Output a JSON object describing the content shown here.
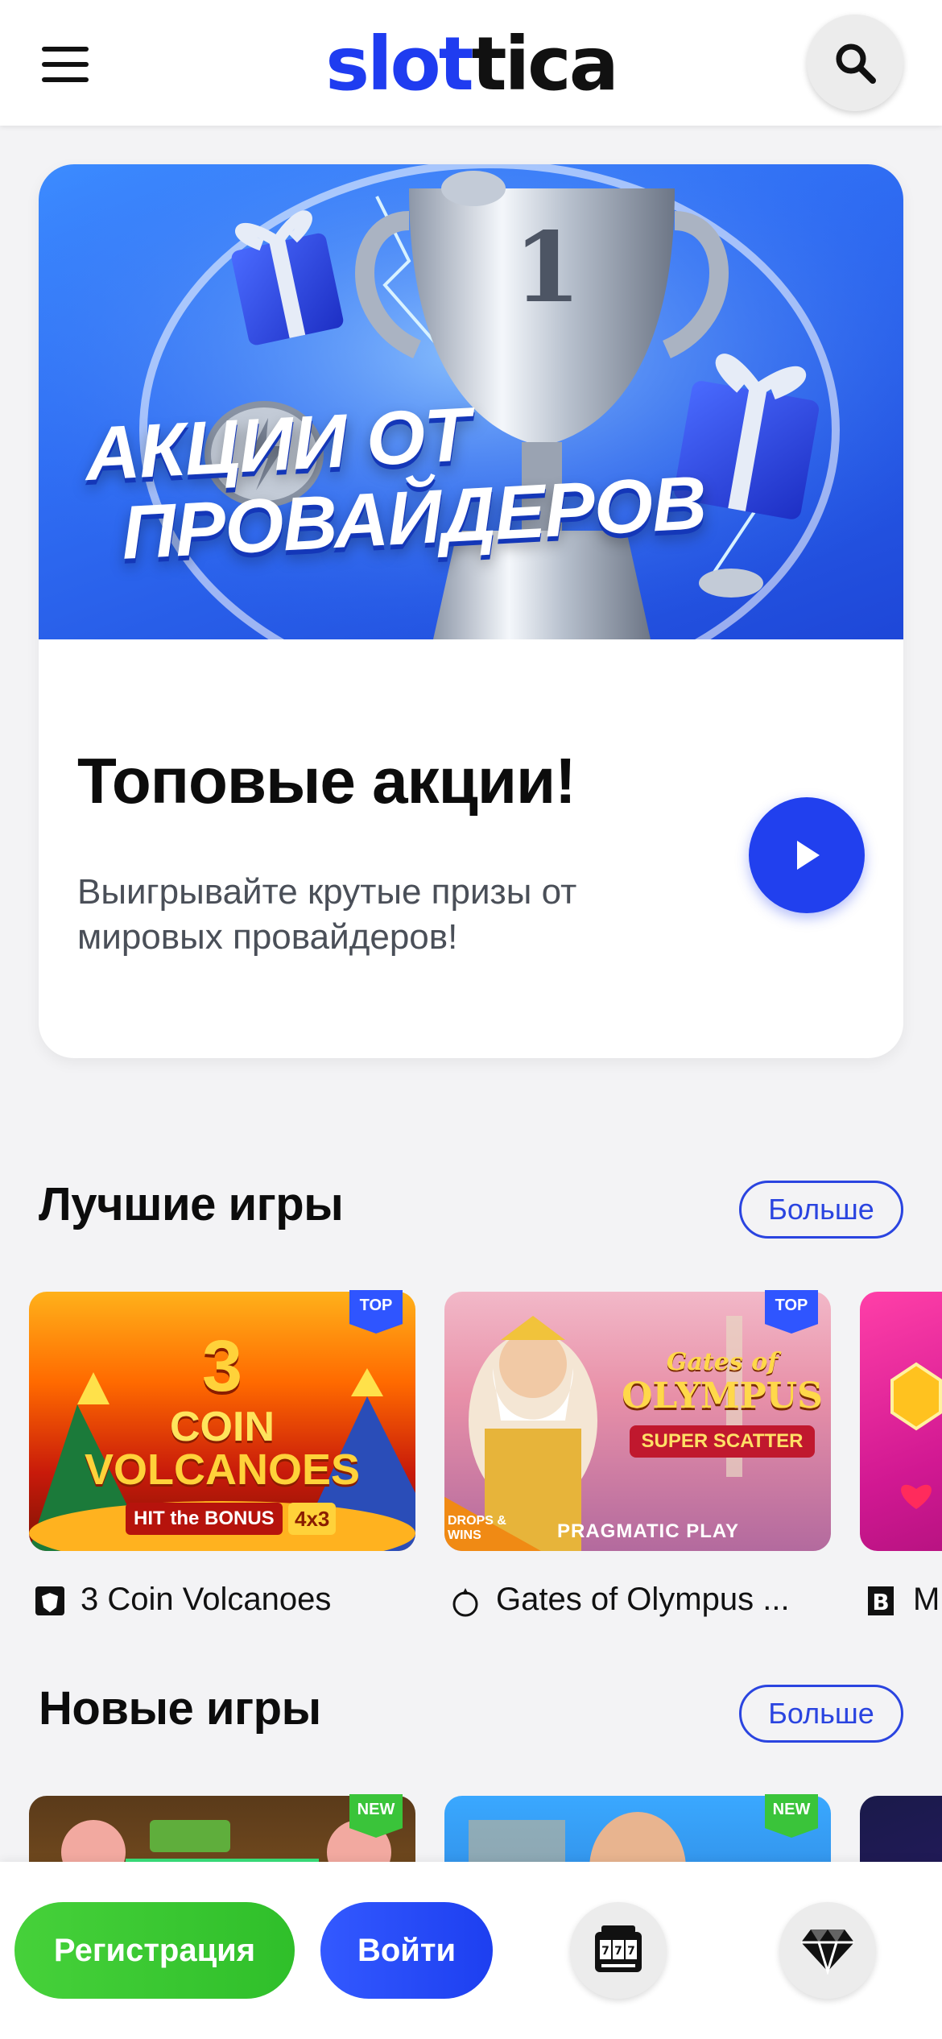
{
  "header": {
    "logo_part1": "slot",
    "logo_part2": "tica",
    "menu_icon": "hamburger-icon",
    "search_icon": "search-icon"
  },
  "promo": {
    "banner_line1": "АКЦИИ ОТ",
    "banner_line2": "ПРОВАЙДЕРОВ",
    "title": "Топовые акции!",
    "text": "Выигрывайте крутые призы от мировых провайдеров!",
    "play_icon": "play-icon"
  },
  "best_games": {
    "title": "Лучшие игры",
    "more_label": "Больше",
    "items": [
      {
        "name": "3 Coin Volcanoes",
        "badge": "TOP",
        "thumb_line1": "3",
        "thumb_line2": "COIN",
        "thumb_line3": "VOLCANOES",
        "thumb_line4": "HIT the BONUS",
        "thumb_line5": "4x3"
      },
      {
        "name": "Gates of Olympus ...",
        "badge": "TOP",
        "thumb_line1": "Gates of",
        "thumb_line2": "OLYMPUS",
        "thumb_line3": "SUPER SCATTER",
        "thumb_line4": "PRAGMATIC PLAY",
        "thumb_line5": "DROPS & WINS"
      },
      {
        "name": "M"
      }
    ]
  },
  "new_games": {
    "title": "Новые игры",
    "more_label": "Больше",
    "items": [
      {
        "badge": "NEW"
      },
      {
        "badge": "NEW"
      }
    ]
  },
  "bottom_bar": {
    "register_label": "Регистрация",
    "login_label": "Войти",
    "slots_icon": "slot-machine-icon",
    "diamond_icon": "diamond-icon"
  },
  "colors": {
    "brand_blue": "#1f3cf0",
    "green": "#2fbf2a",
    "top_badge": "#2f55ff",
    "new_badge": "#3ac43a"
  }
}
